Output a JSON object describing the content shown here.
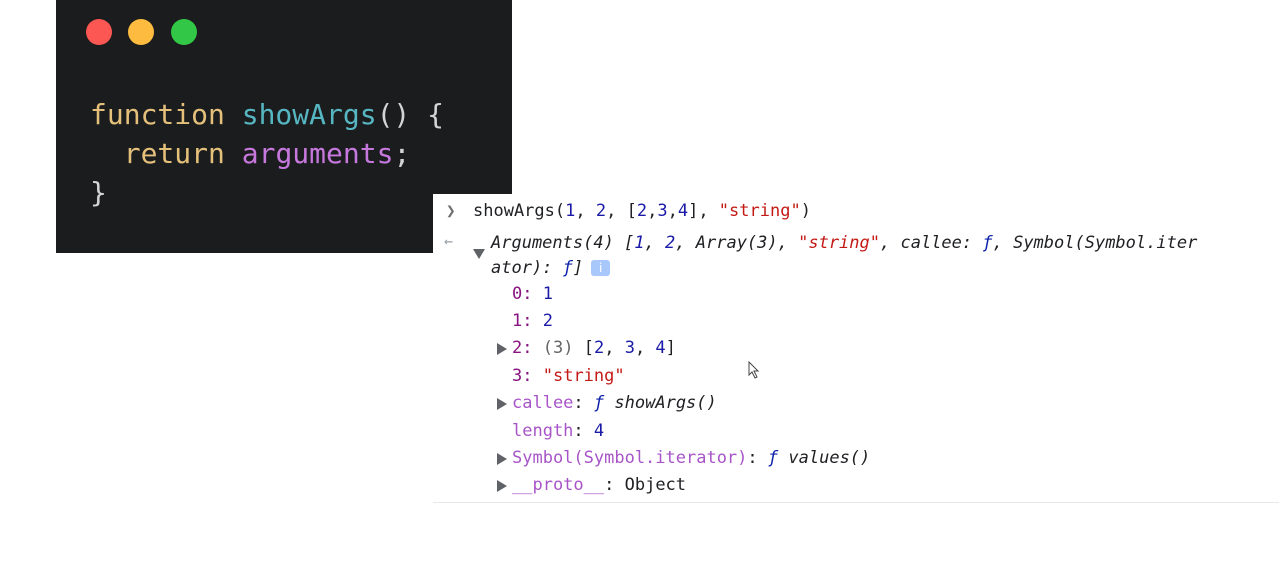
{
  "window_controls": {
    "close_color": "#fc5753",
    "minimize_color": "#fdbc40",
    "maximize_color": "#33c748"
  },
  "code": {
    "kw_function": "function",
    "fn_name": "showArgs",
    "sig_rest": "() {",
    "kw_return": "return",
    "var_arguments": "arguments",
    "semicolon": ";",
    "close_brace": "}"
  },
  "console": {
    "input": {
      "fn": "showArgs(",
      "a1": "1",
      "sep1": ", ",
      "a2": "2",
      "sep2": ", [",
      "a3a": "2",
      "c1": ",",
      "a3b": "3",
      "c2": ",",
      "a3c": "4",
      "close": "], ",
      "a4": "\"string\"",
      "end": ")"
    },
    "summary": {
      "label": "Arguments(4) [",
      "v1": "1",
      "s1": ", ",
      "v2": "2",
      "s2": ", Array(3), ",
      "v3": "\"string\"",
      "rest_line1": ", callee: ",
      "f1": "ƒ",
      "sym_line1": ", Symbol(Symbol.iter",
      "line2": "ator): ",
      "f2": "ƒ",
      "line2_end": "]",
      "info": "i"
    },
    "props": {
      "p0_key": "0",
      "p0_val": "1",
      "p1_key": "1",
      "p1_val": "2",
      "p2_key": "2",
      "p2_len": "(3)",
      "p2_open": "[",
      "p2_v1": "2",
      "p2_v2": "3",
      "p2_v3": "4",
      "p2_close": "]",
      "p3_key": "3",
      "p3_val": "\"string\"",
      "callee_key": "callee",
      "callee_f": "ƒ",
      "callee_val": "showArgs()",
      "length_key": "length",
      "length_val": "4",
      "symbol_key": "Symbol(Symbol.iterator)",
      "symbol_f": "ƒ",
      "symbol_val": "values()",
      "proto_key": "__proto__",
      "proto_val": "Object"
    }
  }
}
